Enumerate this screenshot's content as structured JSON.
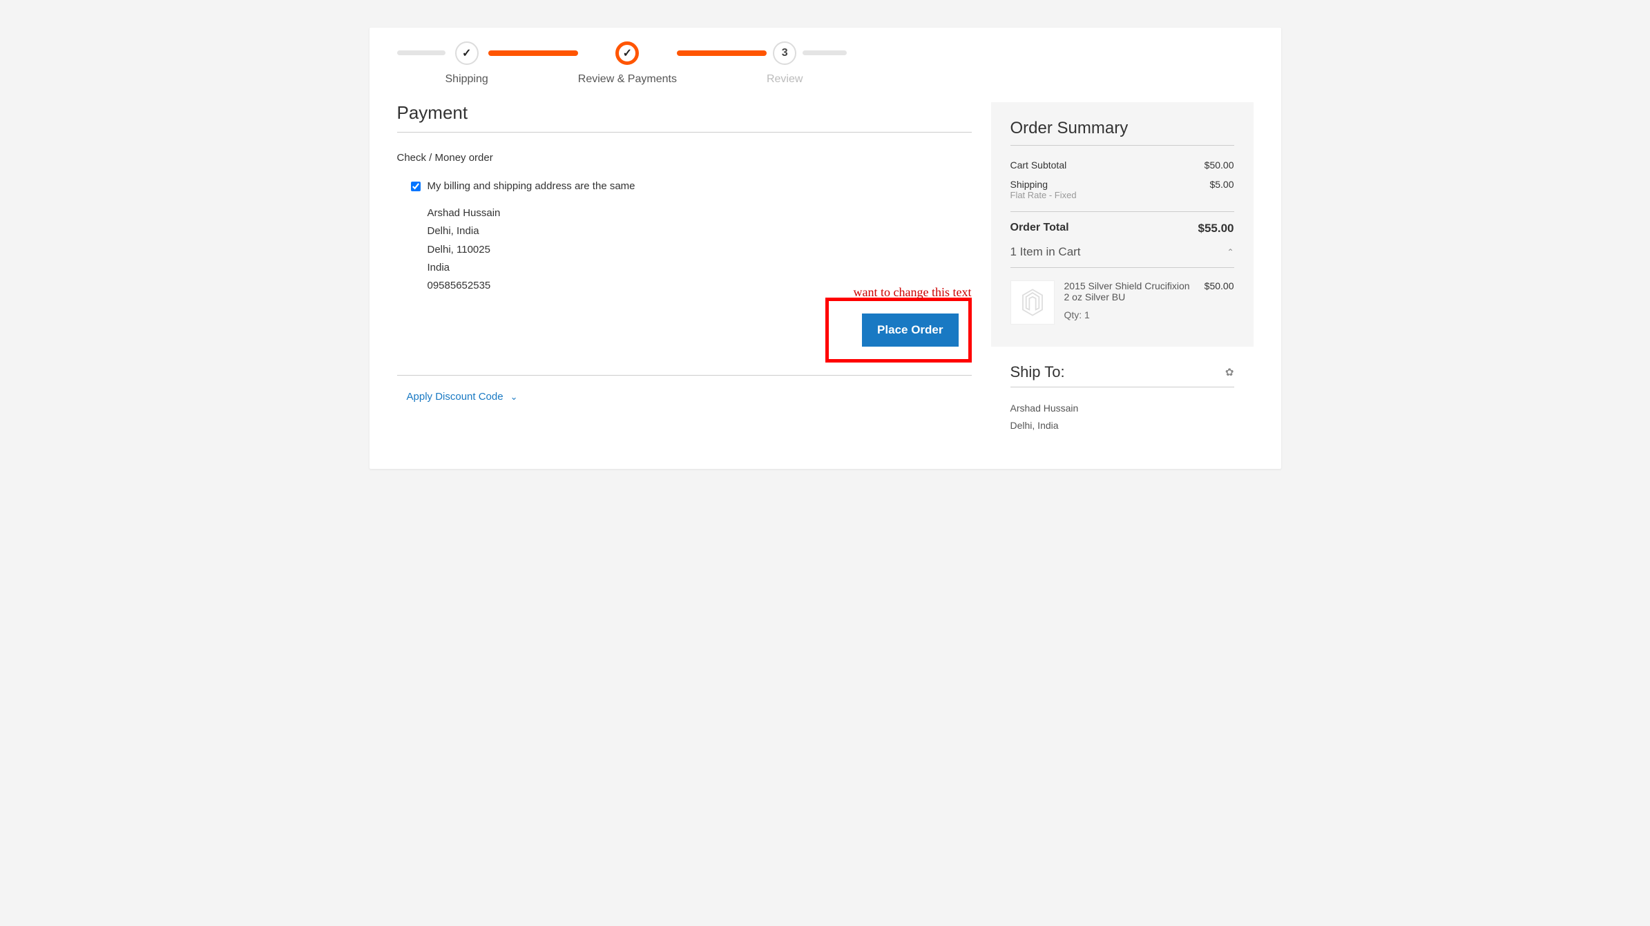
{
  "steps": {
    "shipping": {
      "label": "Shipping"
    },
    "review_payments": {
      "label": "Review & Payments"
    },
    "review": {
      "label": "Review",
      "number": "3"
    }
  },
  "main": {
    "section_title": "Payment",
    "method_label": "Check / Money order",
    "same_address_label": "My billing and shipping address are the same",
    "address": {
      "name": "Arshad Hussain",
      "line1": "Delhi, India",
      "line2": "Delhi, 110025",
      "country": "India",
      "phone": "09585652535"
    },
    "annotation_text": "want to change this text",
    "place_order_label": "Place Order",
    "discount_toggle_label": "Apply Discount Code"
  },
  "summary": {
    "title": "Order Summary",
    "subtotal_label": "Cart Subtotal",
    "subtotal_value": "$50.00",
    "shipping_label": "Shipping",
    "shipping_value": "$5.00",
    "shipping_method": "Flat Rate - Fixed",
    "total_label": "Order Total",
    "total_value": "$55.00",
    "cart_count_label": "1 Item in Cart",
    "item": {
      "name": "2015 Silver Shield Crucifixion 2 oz Silver BU",
      "price": "$50.00",
      "qty_label": "Qty: 1"
    }
  },
  "ship_to": {
    "title": "Ship To:",
    "name": "Arshad Hussain",
    "line1": "Delhi, India"
  }
}
